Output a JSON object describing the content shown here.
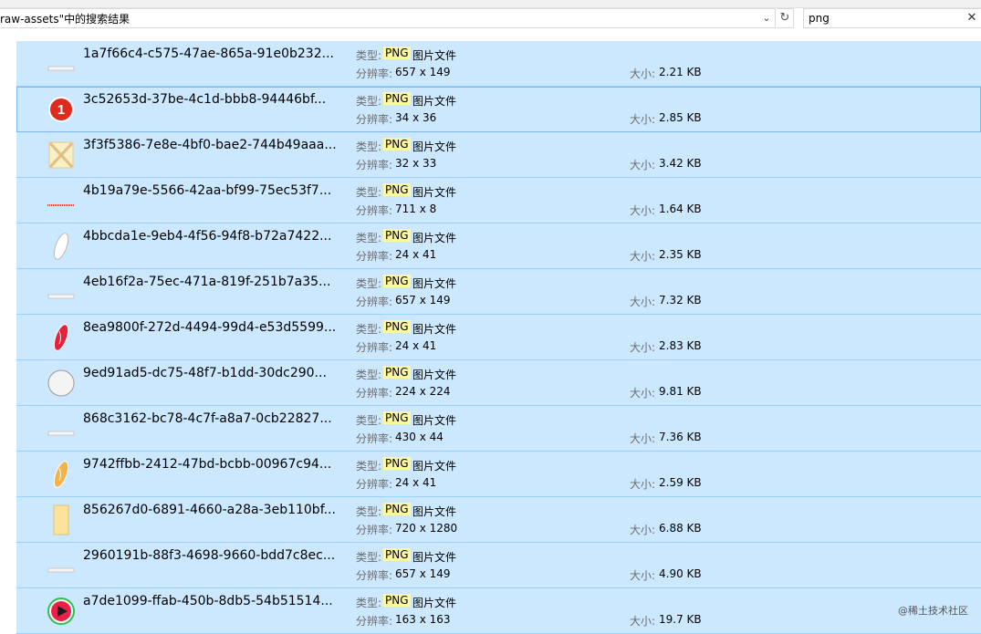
{
  "address": {
    "text": "raw-assets\"中的搜索结果"
  },
  "search": {
    "value": "png"
  },
  "labels": {
    "type": "类型:",
    "type_hl": "PNG",
    "type_rest": "图片文件",
    "resolution": "分辨率:",
    "size": "大小:"
  },
  "rows": [
    {
      "name": "1a7f66c4-c575-47ae-865a-91e0b232...",
      "res": "657 x 149",
      "size": "2.21 KB",
      "icon": "thin-bar-thumbnail-icon"
    },
    {
      "name": "3c52653d-37be-4c1d-bbb8-94446bf...",
      "res": "34 x 36",
      "size": "2.85 KB",
      "icon": "red-badge-one-thumbnail-icon"
    },
    {
      "name": "3f3f5386-7e8e-4bf0-bae2-744b49aaa...",
      "res": "32 x 33",
      "size": "3.42 KB",
      "icon": "cross-tile-thumbnail-icon"
    },
    {
      "name": "4b19a79e-5566-42aa-bf99-75ec53f7...",
      "res": "711 x 8",
      "size": "1.64 KB",
      "icon": "red-dotted-line-thumbnail-icon"
    },
    {
      "name": "4bbcda1e-9eb4-4f56-94f8-b72a7422...",
      "res": "24 x 41",
      "size": "2.35 KB",
      "icon": "white-leaf-thumbnail-icon"
    },
    {
      "name": "4eb16f2a-75ec-471a-819f-251b7a35...",
      "res": "657 x 149",
      "size": "7.32 KB",
      "icon": "thin-bar-thumbnail-icon"
    },
    {
      "name": "8ea9800f-272d-4494-99d4-e53d5599...",
      "res": "24 x 41",
      "size": "2.83 KB",
      "icon": "red-leaf-thumbnail-icon"
    },
    {
      "name": "9ed91ad5-dc75-48f7-b1dd-30dc290...",
      "res": "224 x 224",
      "size": "9.81 KB",
      "icon": "circle-thumbnail-icon"
    },
    {
      "name": "868c3162-bc78-4c7f-a8a7-0cb22827...",
      "res": "430 x 44",
      "size": "7.36 KB",
      "icon": "thin-bar-thumbnail-icon"
    },
    {
      "name": "9742ffbb-2412-47bd-bcbb-00967c94...",
      "res": "24 x 41",
      "size": "2.59 KB",
      "icon": "orange-leaf-thumbnail-icon"
    },
    {
      "name": "856267d0-6891-4660-a28a-3eb110bf...",
      "res": "720 x 1280",
      "size": "6.88 KB",
      "icon": "yellow-page-thumbnail-icon"
    },
    {
      "name": "2960191b-88f3-4698-9660-bdd7c8ec...",
      "res": "657 x 149",
      "size": "4.90 KB",
      "icon": "thin-bar-thumbnail-icon"
    },
    {
      "name": "a7de1099-ffab-450b-8db5-54b51514...",
      "res": "163 x 163",
      "size": "19.7 KB",
      "icon": "play-button-thumbnail-icon"
    }
  ],
  "watermark": "@稀土技术社区"
}
